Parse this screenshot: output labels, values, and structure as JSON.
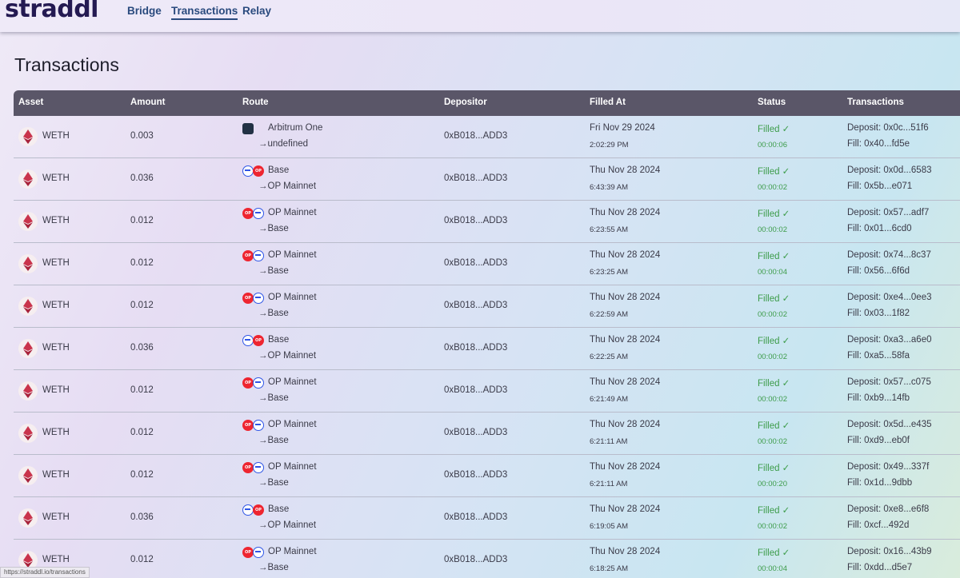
{
  "header": {
    "logo": "straddl",
    "nav": [
      {
        "label": "Bridge"
      },
      {
        "label": "Transactions"
      },
      {
        "label": "Relay"
      }
    ]
  },
  "page_title": "Transactions",
  "table": {
    "columns": [
      "Asset",
      "Amount",
      "Route",
      "Depositor",
      "Filled At",
      "Status",
      "Transactions"
    ],
    "rows": [
      {
        "asset": "WETH",
        "amount": "0.003",
        "from_chain": "Arbitrum One",
        "to_chain": "→undefined",
        "chain_icons": "arbitrum-icon",
        "depositor": "0xB018...ADD3",
        "filled_date": "Fri Nov 29 2024",
        "filled_time": "2:02:29 PM",
        "status": "Filled ✓",
        "duration": "00:00:06",
        "deposit": "Deposit: 0x0c...51f6",
        "fill": "Fill: 0x40...fd5e"
      },
      {
        "asset": "WETH",
        "amount": "0.036",
        "from_chain": "Base",
        "to_chain": "→OP Mainnet",
        "chain_icons": "base-op",
        "depositor": "0xB018...ADD3",
        "filled_date": "Thu Nov 28 2024",
        "filled_time": "6:43:39 AM",
        "status": "Filled ✓",
        "duration": "00:00:02",
        "deposit": "Deposit: 0x0d...6583",
        "fill": "Fill: 0x5b...e071"
      },
      {
        "asset": "WETH",
        "amount": "0.012",
        "from_chain": "OP Mainnet",
        "to_chain": "→Base",
        "chain_icons": "op-base",
        "depositor": "0xB018...ADD3",
        "filled_date": "Thu Nov 28 2024",
        "filled_time": "6:23:55 AM",
        "status": "Filled ✓",
        "duration": "00:00:02",
        "deposit": "Deposit: 0x57...adf7",
        "fill": "Fill: 0x01...6cd0"
      },
      {
        "asset": "WETH",
        "amount": "0.012",
        "from_chain": "OP Mainnet",
        "to_chain": "→Base",
        "chain_icons": "op-base",
        "depositor": "0xB018...ADD3",
        "filled_date": "Thu Nov 28 2024",
        "filled_time": "6:23:25 AM",
        "status": "Filled ✓",
        "duration": "00:00:04",
        "deposit": "Deposit: 0x74...8c37",
        "fill": "Fill: 0x56...6f6d"
      },
      {
        "asset": "WETH",
        "amount": "0.012",
        "from_chain": "OP Mainnet",
        "to_chain": "→Base",
        "chain_icons": "op-base",
        "depositor": "0xB018...ADD3",
        "filled_date": "Thu Nov 28 2024",
        "filled_time": "6:22:59 AM",
        "status": "Filled ✓",
        "duration": "00:00:02",
        "deposit": "Deposit: 0xe4...0ee3",
        "fill": "Fill: 0x03...1f82"
      },
      {
        "asset": "WETH",
        "amount": "0.036",
        "from_chain": "Base",
        "to_chain": "→OP Mainnet",
        "chain_icons": "base-op",
        "depositor": "0xB018...ADD3",
        "filled_date": "Thu Nov 28 2024",
        "filled_time": "6:22:25 AM",
        "status": "Filled ✓",
        "duration": "00:00:02",
        "deposit": "Deposit: 0xa3...a6e0",
        "fill": "Fill: 0xa5...58fa"
      },
      {
        "asset": "WETH",
        "amount": "0.012",
        "from_chain": "OP Mainnet",
        "to_chain": "→Base",
        "chain_icons": "op-base",
        "depositor": "0xB018...ADD3",
        "filled_date": "Thu Nov 28 2024",
        "filled_time": "6:21:49 AM",
        "status": "Filled ✓",
        "duration": "00:00:02",
        "deposit": "Deposit: 0x57...c075",
        "fill": "Fill: 0xb9...14fb"
      },
      {
        "asset": "WETH",
        "amount": "0.012",
        "from_chain": "OP Mainnet",
        "to_chain": "→Base",
        "chain_icons": "op-base",
        "depositor": "0xB018...ADD3",
        "filled_date": "Thu Nov 28 2024",
        "filled_time": "6:21:11 AM",
        "status": "Filled ✓",
        "duration": "00:00:02",
        "deposit": "Deposit: 0x5d...e435",
        "fill": "Fill: 0xd9...eb0f"
      },
      {
        "asset": "WETH",
        "amount": "0.012",
        "from_chain": "OP Mainnet",
        "to_chain": "→Base",
        "chain_icons": "op-base",
        "depositor": "0xB018...ADD3",
        "filled_date": "Thu Nov 28 2024",
        "filled_time": "6:21:11 AM",
        "status": "Filled ✓",
        "duration": "00:00:20",
        "deposit": "Deposit: 0x49...337f",
        "fill": "Fill: 0x1d...9dbb"
      },
      {
        "asset": "WETH",
        "amount": "0.036",
        "from_chain": "Base",
        "to_chain": "→OP Mainnet",
        "chain_icons": "base-op",
        "depositor": "0xB018...ADD3",
        "filled_date": "Thu Nov 28 2024",
        "filled_time": "6:19:05 AM",
        "status": "Filled ✓",
        "duration": "00:00:02",
        "deposit": "Deposit: 0xe8...e6f8",
        "fill": "Fill: 0xcf...492d"
      },
      {
        "asset": "WETH",
        "amount": "0.012",
        "from_chain": "OP Mainnet",
        "to_chain": "→Base",
        "chain_icons": "op-base",
        "depositor": "0xB018...ADD3",
        "filled_date": "Thu Nov 28 2024",
        "filled_time": "6:18:25 AM",
        "status": "Filled ✓",
        "duration": "00:00:04",
        "deposit": "Deposit: 0x16...43b9",
        "fill": "Fill: 0xdd...d5e7"
      }
    ]
  },
  "browser_status_url": "https://straddl.io/transactions",
  "colors": {
    "header_bg": "#5a5668",
    "filled_green": "#3d9c4a",
    "op_red": "#ee2530",
    "base_blue": "#2e55e6"
  }
}
